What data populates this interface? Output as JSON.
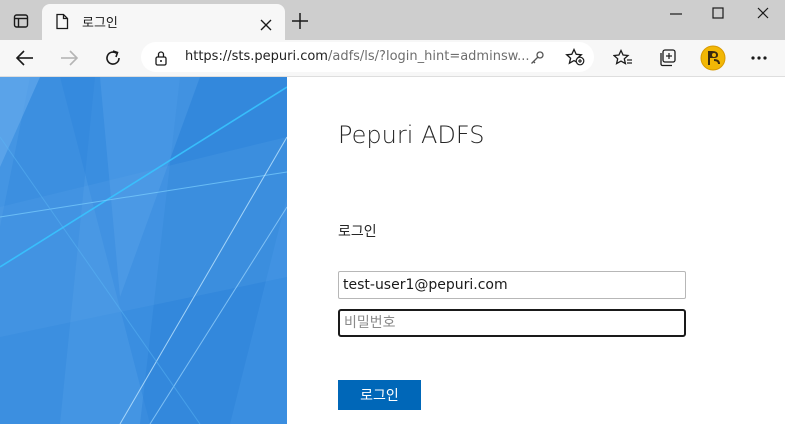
{
  "browser": {
    "tab": {
      "title": "로그인"
    },
    "address_bar": {
      "url_host": "https://sts.pepuri.com",
      "url_path": "/adfs/ls/?login_hint=adminsw..."
    }
  },
  "page": {
    "org_name": "Pepuri ADFS",
    "section_title": "로그인",
    "username_value": "test-user1@pepuri.com",
    "password_placeholder": "비밀번호",
    "signin_label": "로그인"
  },
  "colors": {
    "tabbar": "#cecece",
    "toolbar": "#f7f7f7",
    "illustration": "#3b8fe0",
    "accent": "#0067b8"
  },
  "icons": {
    "tab_actions": "tab-actions-icon",
    "page": "page-icon",
    "close_tab": "close-icon",
    "new_tab": "plus-icon",
    "back": "back-arrow-icon",
    "forward": "forward-arrow-icon",
    "refresh": "refresh-icon",
    "lock": "lock-icon",
    "key": "key-icon",
    "add_favorite": "star-add-icon",
    "favorites": "favorites-icon",
    "collections": "collections-icon",
    "profile": "profile-avatar-icon",
    "more": "more-dots-icon"
  }
}
